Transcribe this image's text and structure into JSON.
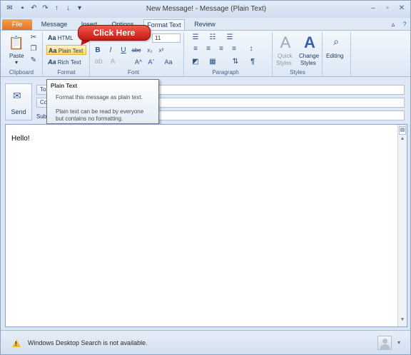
{
  "window": {
    "title": "New Message! - Message (Plain Text)",
    "controls": {
      "minimize": "–",
      "restore": "▫",
      "close": "✕"
    }
  },
  "quick_access": {
    "icons": [
      "save-icon",
      "undo-icon",
      "redo-icon",
      "up-arrow-icon",
      "down-arrow-icon",
      "customize-icon"
    ]
  },
  "tabs": [
    "File",
    "Message",
    "Insert",
    "Options",
    "Format Text",
    "Review"
  ],
  "ribbon": {
    "clipboard": {
      "paste_label": "Paste",
      "group_label": "Clipboard"
    },
    "format": {
      "html_label": "HTML",
      "plain_label": "Plain Text",
      "rich_label": "Rich Text",
      "group_label": "Format"
    },
    "font": {
      "size": "11",
      "bold": "B",
      "italic": "I",
      "underline": "U",
      "strike": "abc",
      "sub": "x₂",
      "sup": "x²",
      "grow": "A^",
      "shrink": "Aˇ",
      "case": "Aa",
      "group_label": "Font"
    },
    "paragraph": {
      "group_label": "Paragraph"
    },
    "styles": {
      "quick_label_1": "Quick",
      "quick_label_2": "Styles",
      "change_label_1": "Change",
      "change_label_2": "Styles",
      "group_label": "Styles"
    },
    "editing": {
      "label": "Editing"
    }
  },
  "callout": {
    "text": "Click Here"
  },
  "tooltip": {
    "title": "Plain Text",
    "line1": "Format this message as plain text.",
    "line2": "Plain text can be read by everyone",
    "line3": "but contains no formatting."
  },
  "header": {
    "send_label": "Send",
    "to_label": "To",
    "cc_label": "Cc",
    "subject_label": "Subject"
  },
  "body": {
    "text": "Hello!"
  },
  "status": {
    "text": "Windows Desktop Search is not available."
  },
  "colors": {
    "accent": "#e3722a",
    "callout": "#c61a12",
    "ribbon": "#dde8f5"
  }
}
